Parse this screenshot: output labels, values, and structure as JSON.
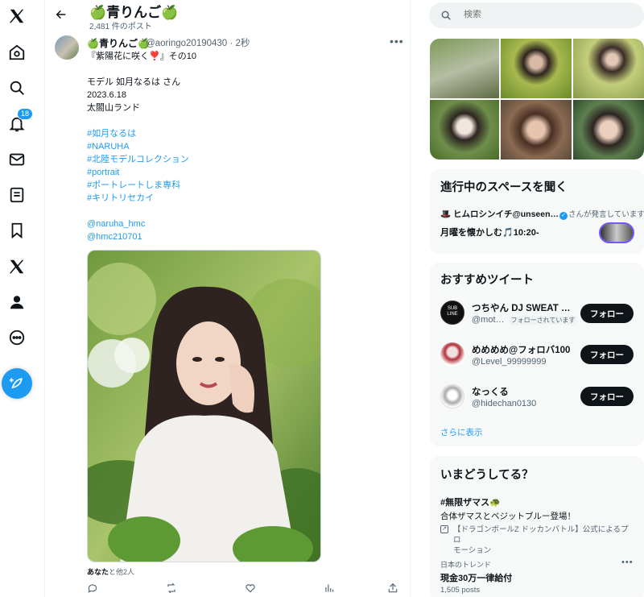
{
  "nav": {
    "notifications_badge": "18"
  },
  "header": {
    "title": "🍏青りんご🍏",
    "post_count": "2,481 件のポスト"
  },
  "tweet": {
    "author_name": "🍏青りんご🍏",
    "author_handle": "@aoringo20190430",
    "time": "· 2秒",
    "lines": [
      {
        "text": "『紫陽花に咲く❣️』その10",
        "link": false
      },
      {
        "text": "",
        "link": false
      },
      {
        "text": "モデル 如月なるは さん",
        "link": false
      },
      {
        "text": "2023.6.18",
        "link": false
      },
      {
        "text": "太閤山ランド",
        "link": false
      },
      {
        "text": "",
        "link": false
      },
      {
        "text": "#如月なるは",
        "link": true
      },
      {
        "text": "#NARUHA",
        "link": true
      },
      {
        "text": "#北陸モデルコレクション",
        "link": true
      },
      {
        "text": "#portrait",
        "link": true
      },
      {
        "text": "#ポートレートしま専科",
        "link": true
      },
      {
        "text": "#キリトリセカイ",
        "link": true
      },
      {
        "text": "",
        "link": false
      },
      {
        "text": "@naruha_hmc",
        "link": true
      },
      {
        "text": "@hmc210701",
        "link": true
      }
    ],
    "likers_bold": "あなた",
    "likers_rest": "と他2人"
  },
  "search": {
    "placeholder": "検索"
  },
  "spaces": {
    "title": "進行中のスペースを聞く",
    "host": "ヒムロシンイチ@unseen…",
    "host_suffix": "さんが発言しています",
    "space_title": "月曜を懐かしむ🎵10:20-"
  },
  "recommend": {
    "title": "おすすめツイート",
    "follow_label": "フォロー",
    "users": [
      {
        "name": "つちやん DJ SWEAT …",
        "handle": "@mot…",
        "follows_you": "フォローされています"
      },
      {
        "name": "めめめめ@フォロバ100",
        "handle": "@Level_99999999",
        "follows_you": ""
      },
      {
        "name": "なっくる",
        "handle": "@hidechan0130",
        "follows_you": ""
      }
    ],
    "show_more": "さらに表示"
  },
  "trends": {
    "title": "いまどうしてる？",
    "promo_tag": "#無限ザマス🐢",
    "promo_desc": "合体ザマスとベジットブルー登場！",
    "promo_by_1": "【ドラゴンボールZ ドッカンバトル】公式によるプロ",
    "promo_by_2": "モーション",
    "trend_context": "日本のトレンド",
    "trend_name": "現金30万一律給付",
    "trend_posts": "1,505 posts"
  },
  "colors": {
    "accent": "#1d9bf0",
    "text": "#0f1419",
    "muted": "#536471",
    "card_bg": "#f7f9f9"
  }
}
